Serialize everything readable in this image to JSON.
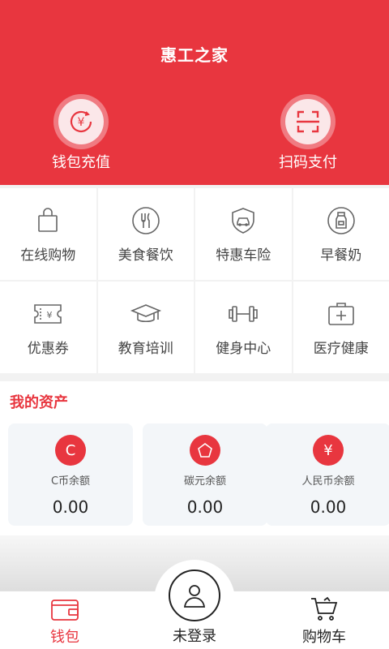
{
  "header": {
    "title": "惠工之家",
    "actions": [
      {
        "label": "钱包充值",
        "icon": "yuan-refresh-icon"
      },
      {
        "label": "扫码支付",
        "icon": "scan-icon"
      }
    ]
  },
  "services": [
    {
      "label": "在线购物",
      "icon": "shopping-bag-icon"
    },
    {
      "label": "美食餐饮",
      "icon": "fork-knife-icon"
    },
    {
      "label": "特惠车险",
      "icon": "car-shield-icon"
    },
    {
      "label": "早餐奶",
      "icon": "milk-bottle-icon"
    },
    {
      "label": "优惠券",
      "icon": "coupon-icon"
    },
    {
      "label": "教育培训",
      "icon": "graduation-cap-icon"
    },
    {
      "label": "健身中心",
      "icon": "dumbbell-icon"
    },
    {
      "label": "医疗健康",
      "icon": "medical-kit-icon"
    }
  ],
  "assets": {
    "title": "我的资产",
    "items": [
      {
        "label": "C币余额",
        "value": "0.00",
        "symbol": "C"
      },
      {
        "label": "碳元余额",
        "value": "0.00",
        "symbol": "pentagon"
      },
      {
        "label": "人民币余额",
        "value": "0.00",
        "symbol": "¥"
      }
    ]
  },
  "tabbar": {
    "wallet": "钱包",
    "login": "未登录",
    "cart": "购物车"
  },
  "colors": {
    "accent": "#e8363f"
  }
}
